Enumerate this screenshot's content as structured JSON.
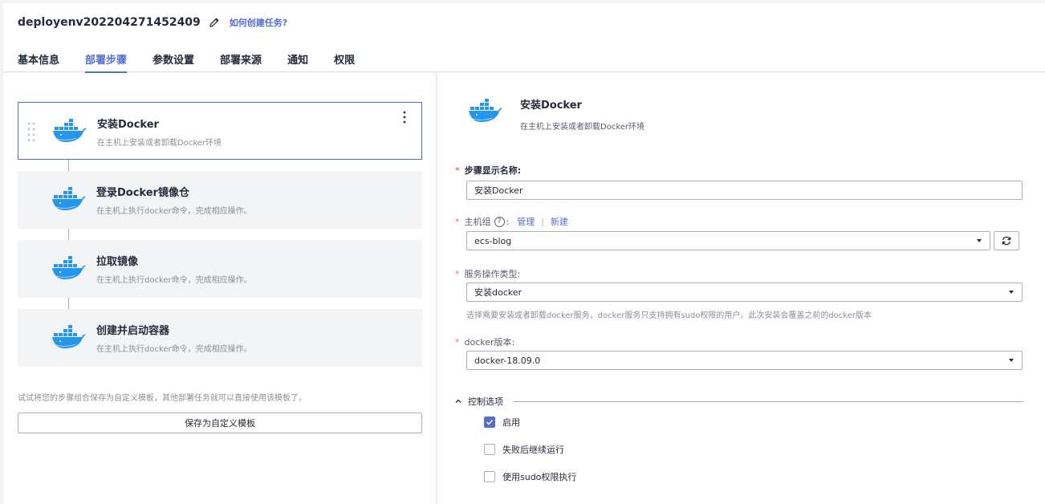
{
  "header": {
    "task_name": "deployenv202204271452409",
    "help_link": "如何创建任务?",
    "tabs": [
      {
        "label": "基本信息",
        "active": false
      },
      {
        "label": "部署步骤",
        "active": true
      },
      {
        "label": "参数设置",
        "active": false
      },
      {
        "label": "部署来源",
        "active": false
      },
      {
        "label": "通知",
        "active": false
      },
      {
        "label": "权限",
        "active": false
      }
    ]
  },
  "steps": [
    {
      "title": "安装Docker",
      "desc": "在主机上安装或者卸载Docker环境",
      "selected": true
    },
    {
      "title": "登录Docker镜像仓",
      "desc": "在主机上执行docker命令，完成相应操作。",
      "selected": false
    },
    {
      "title": "拉取镜像",
      "desc": "在主机上执行docker命令，完成相应操作。",
      "selected": false
    },
    {
      "title": "创建并启动容器",
      "desc": "在主机上执行docker命令，完成相应操作。",
      "selected": false
    }
  ],
  "left_footer": {
    "tip": "试试将您的步骤组合保存为自定义模板，其他部署任务就可以直接使用该模板了。",
    "save_template_label": "保存为自定义模板"
  },
  "detail": {
    "title": "安装Docker",
    "desc": "在主机上安装或者卸载Docker环境",
    "step_name": {
      "label": "步骤显示名称:",
      "value": "安装Docker"
    },
    "host_group": {
      "label": "主机组",
      "qmark": "?",
      "colon": ":",
      "manage": "管理",
      "separator": "|",
      "create": "新建",
      "value": "ecs-blog"
    },
    "operation_type": {
      "label": "服务操作类型:",
      "value": "安装docker",
      "hint": "选择需要安装或者卸载docker服务，docker服务只支持拥有sudo权限的用户。此次安装会覆盖之前的docker版本"
    },
    "docker_version": {
      "label": "docker版本:",
      "value": "docker-18.09.0"
    },
    "required_mark": "*",
    "control_options": {
      "title": "控制选项",
      "options": [
        {
          "label": "启用",
          "checked": true
        },
        {
          "label": "失败后继续运行",
          "checked": false
        },
        {
          "label": "使用sudo权限执行",
          "checked": false
        }
      ]
    }
  },
  "colors": {
    "accent": "#526ecc",
    "required": "#f66f6a",
    "docker_blue": "#2496ed"
  },
  "icons": {
    "edit": "pencil-icon",
    "step": "docker-whale-icon",
    "refresh": "refresh-icon",
    "more": "more-vertical-icon",
    "drag": "drag-handle-icon",
    "collapse": "chevron-up-icon",
    "check": "check-icon"
  }
}
